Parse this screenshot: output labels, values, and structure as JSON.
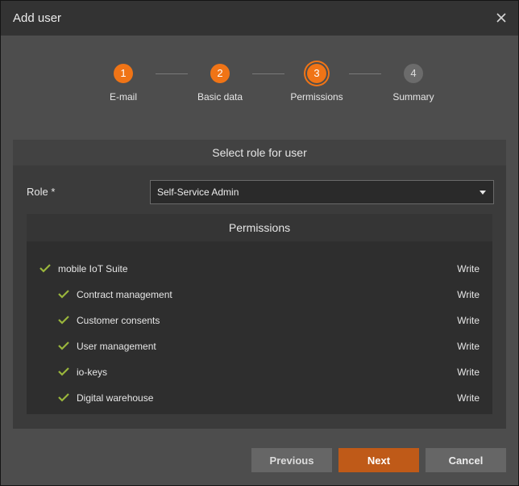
{
  "dialog": {
    "title": "Add user"
  },
  "steps": [
    {
      "number": "1",
      "label": "E-mail",
      "state": "done"
    },
    {
      "number": "2",
      "label": "Basic data",
      "state": "done"
    },
    {
      "number": "3",
      "label": "Permissions",
      "state": "active"
    },
    {
      "number": "4",
      "label": "Summary",
      "state": "todo"
    }
  ],
  "role_section": {
    "title": "Select role for user",
    "role_label": "Role *",
    "role_value": "Self-Service Admin"
  },
  "permissions": {
    "title": "Permissions",
    "items": [
      {
        "name": "mobile IoT Suite",
        "access": "Write",
        "level": 0
      },
      {
        "name": "Contract management",
        "access": "Write",
        "level": 1
      },
      {
        "name": "Customer consents",
        "access": "Write",
        "level": 1
      },
      {
        "name": "User management",
        "access": "Write",
        "level": 1
      },
      {
        "name": "io-keys",
        "access": "Write",
        "level": 1
      },
      {
        "name": "Digital warehouse",
        "access": "Write",
        "level": 1
      }
    ]
  },
  "buttons": {
    "previous": "Previous",
    "next": "Next",
    "cancel": "Cancel"
  },
  "colors": {
    "accent": "#f07416",
    "check": "#9ab63c",
    "next_button": "#bf5a18"
  },
  "icons": {
    "close": "close-icon",
    "caret": "chevron-down-icon",
    "check": "check-icon"
  }
}
